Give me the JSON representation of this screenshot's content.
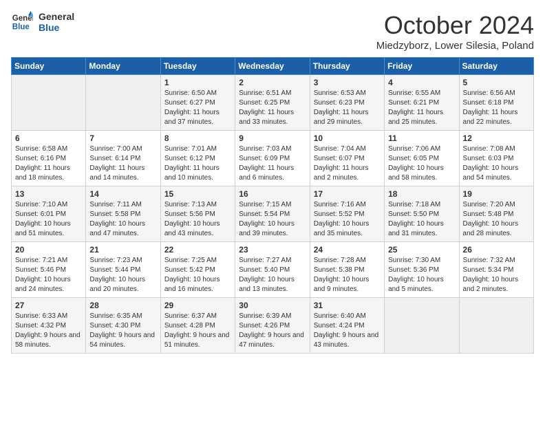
{
  "logo": {
    "line1": "General",
    "line2": "Blue"
  },
  "title": "October 2024",
  "location": "Miedzyborz, Lower Silesia, Poland",
  "days_header": [
    "Sunday",
    "Monday",
    "Tuesday",
    "Wednesday",
    "Thursday",
    "Friday",
    "Saturday"
  ],
  "weeks": [
    [
      {
        "day": "",
        "empty": true
      },
      {
        "day": "",
        "empty": true
      },
      {
        "day": "1",
        "sunrise": "Sunrise: 6:50 AM",
        "sunset": "Sunset: 6:27 PM",
        "daylight": "Daylight: 11 hours and 37 minutes."
      },
      {
        "day": "2",
        "sunrise": "Sunrise: 6:51 AM",
        "sunset": "Sunset: 6:25 PM",
        "daylight": "Daylight: 11 hours and 33 minutes."
      },
      {
        "day": "3",
        "sunrise": "Sunrise: 6:53 AM",
        "sunset": "Sunset: 6:23 PM",
        "daylight": "Daylight: 11 hours and 29 minutes."
      },
      {
        "day": "4",
        "sunrise": "Sunrise: 6:55 AM",
        "sunset": "Sunset: 6:21 PM",
        "daylight": "Daylight: 11 hours and 25 minutes."
      },
      {
        "day": "5",
        "sunrise": "Sunrise: 6:56 AM",
        "sunset": "Sunset: 6:18 PM",
        "daylight": "Daylight: 11 hours and 22 minutes."
      }
    ],
    [
      {
        "day": "6",
        "sunrise": "Sunrise: 6:58 AM",
        "sunset": "Sunset: 6:16 PM",
        "daylight": "Daylight: 11 hours and 18 minutes."
      },
      {
        "day": "7",
        "sunrise": "Sunrise: 7:00 AM",
        "sunset": "Sunset: 6:14 PM",
        "daylight": "Daylight: 11 hours and 14 minutes."
      },
      {
        "day": "8",
        "sunrise": "Sunrise: 7:01 AM",
        "sunset": "Sunset: 6:12 PM",
        "daylight": "Daylight: 11 hours and 10 minutes."
      },
      {
        "day": "9",
        "sunrise": "Sunrise: 7:03 AM",
        "sunset": "Sunset: 6:09 PM",
        "daylight": "Daylight: 11 hours and 6 minutes."
      },
      {
        "day": "10",
        "sunrise": "Sunrise: 7:04 AM",
        "sunset": "Sunset: 6:07 PM",
        "daylight": "Daylight: 11 hours and 2 minutes."
      },
      {
        "day": "11",
        "sunrise": "Sunrise: 7:06 AM",
        "sunset": "Sunset: 6:05 PM",
        "daylight": "Daylight: 10 hours and 58 minutes."
      },
      {
        "day": "12",
        "sunrise": "Sunrise: 7:08 AM",
        "sunset": "Sunset: 6:03 PM",
        "daylight": "Daylight: 10 hours and 54 minutes."
      }
    ],
    [
      {
        "day": "13",
        "sunrise": "Sunrise: 7:10 AM",
        "sunset": "Sunset: 6:01 PM",
        "daylight": "Daylight: 10 hours and 51 minutes."
      },
      {
        "day": "14",
        "sunrise": "Sunrise: 7:11 AM",
        "sunset": "Sunset: 5:58 PM",
        "daylight": "Daylight: 10 hours and 47 minutes."
      },
      {
        "day": "15",
        "sunrise": "Sunrise: 7:13 AM",
        "sunset": "Sunset: 5:56 PM",
        "daylight": "Daylight: 10 hours and 43 minutes."
      },
      {
        "day": "16",
        "sunrise": "Sunrise: 7:15 AM",
        "sunset": "Sunset: 5:54 PM",
        "daylight": "Daylight: 10 hours and 39 minutes."
      },
      {
        "day": "17",
        "sunrise": "Sunrise: 7:16 AM",
        "sunset": "Sunset: 5:52 PM",
        "daylight": "Daylight: 10 hours and 35 minutes."
      },
      {
        "day": "18",
        "sunrise": "Sunrise: 7:18 AM",
        "sunset": "Sunset: 5:50 PM",
        "daylight": "Daylight: 10 hours and 31 minutes."
      },
      {
        "day": "19",
        "sunrise": "Sunrise: 7:20 AM",
        "sunset": "Sunset: 5:48 PM",
        "daylight": "Daylight: 10 hours and 28 minutes."
      }
    ],
    [
      {
        "day": "20",
        "sunrise": "Sunrise: 7:21 AM",
        "sunset": "Sunset: 5:46 PM",
        "daylight": "Daylight: 10 hours and 24 minutes."
      },
      {
        "day": "21",
        "sunrise": "Sunrise: 7:23 AM",
        "sunset": "Sunset: 5:44 PM",
        "daylight": "Daylight: 10 hours and 20 minutes."
      },
      {
        "day": "22",
        "sunrise": "Sunrise: 7:25 AM",
        "sunset": "Sunset: 5:42 PM",
        "daylight": "Daylight: 10 hours and 16 minutes."
      },
      {
        "day": "23",
        "sunrise": "Sunrise: 7:27 AM",
        "sunset": "Sunset: 5:40 PM",
        "daylight": "Daylight: 10 hours and 13 minutes."
      },
      {
        "day": "24",
        "sunrise": "Sunrise: 7:28 AM",
        "sunset": "Sunset: 5:38 PM",
        "daylight": "Daylight: 10 hours and 9 minutes."
      },
      {
        "day": "25",
        "sunrise": "Sunrise: 7:30 AM",
        "sunset": "Sunset: 5:36 PM",
        "daylight": "Daylight: 10 hours and 5 minutes."
      },
      {
        "day": "26",
        "sunrise": "Sunrise: 7:32 AM",
        "sunset": "Sunset: 5:34 PM",
        "daylight": "Daylight: 10 hours and 2 minutes."
      }
    ],
    [
      {
        "day": "27",
        "sunrise": "Sunrise: 6:33 AM",
        "sunset": "Sunset: 4:32 PM",
        "daylight": "Daylight: 9 hours and 58 minutes."
      },
      {
        "day": "28",
        "sunrise": "Sunrise: 6:35 AM",
        "sunset": "Sunset: 4:30 PM",
        "daylight": "Daylight: 9 hours and 54 minutes."
      },
      {
        "day": "29",
        "sunrise": "Sunrise: 6:37 AM",
        "sunset": "Sunset: 4:28 PM",
        "daylight": "Daylight: 9 hours and 51 minutes."
      },
      {
        "day": "30",
        "sunrise": "Sunrise: 6:39 AM",
        "sunset": "Sunset: 4:26 PM",
        "daylight": "Daylight: 9 hours and 47 minutes."
      },
      {
        "day": "31",
        "sunrise": "Sunrise: 6:40 AM",
        "sunset": "Sunset: 4:24 PM",
        "daylight": "Daylight: 9 hours and 43 minutes."
      },
      {
        "day": "",
        "empty": true
      },
      {
        "day": "",
        "empty": true
      }
    ]
  ]
}
